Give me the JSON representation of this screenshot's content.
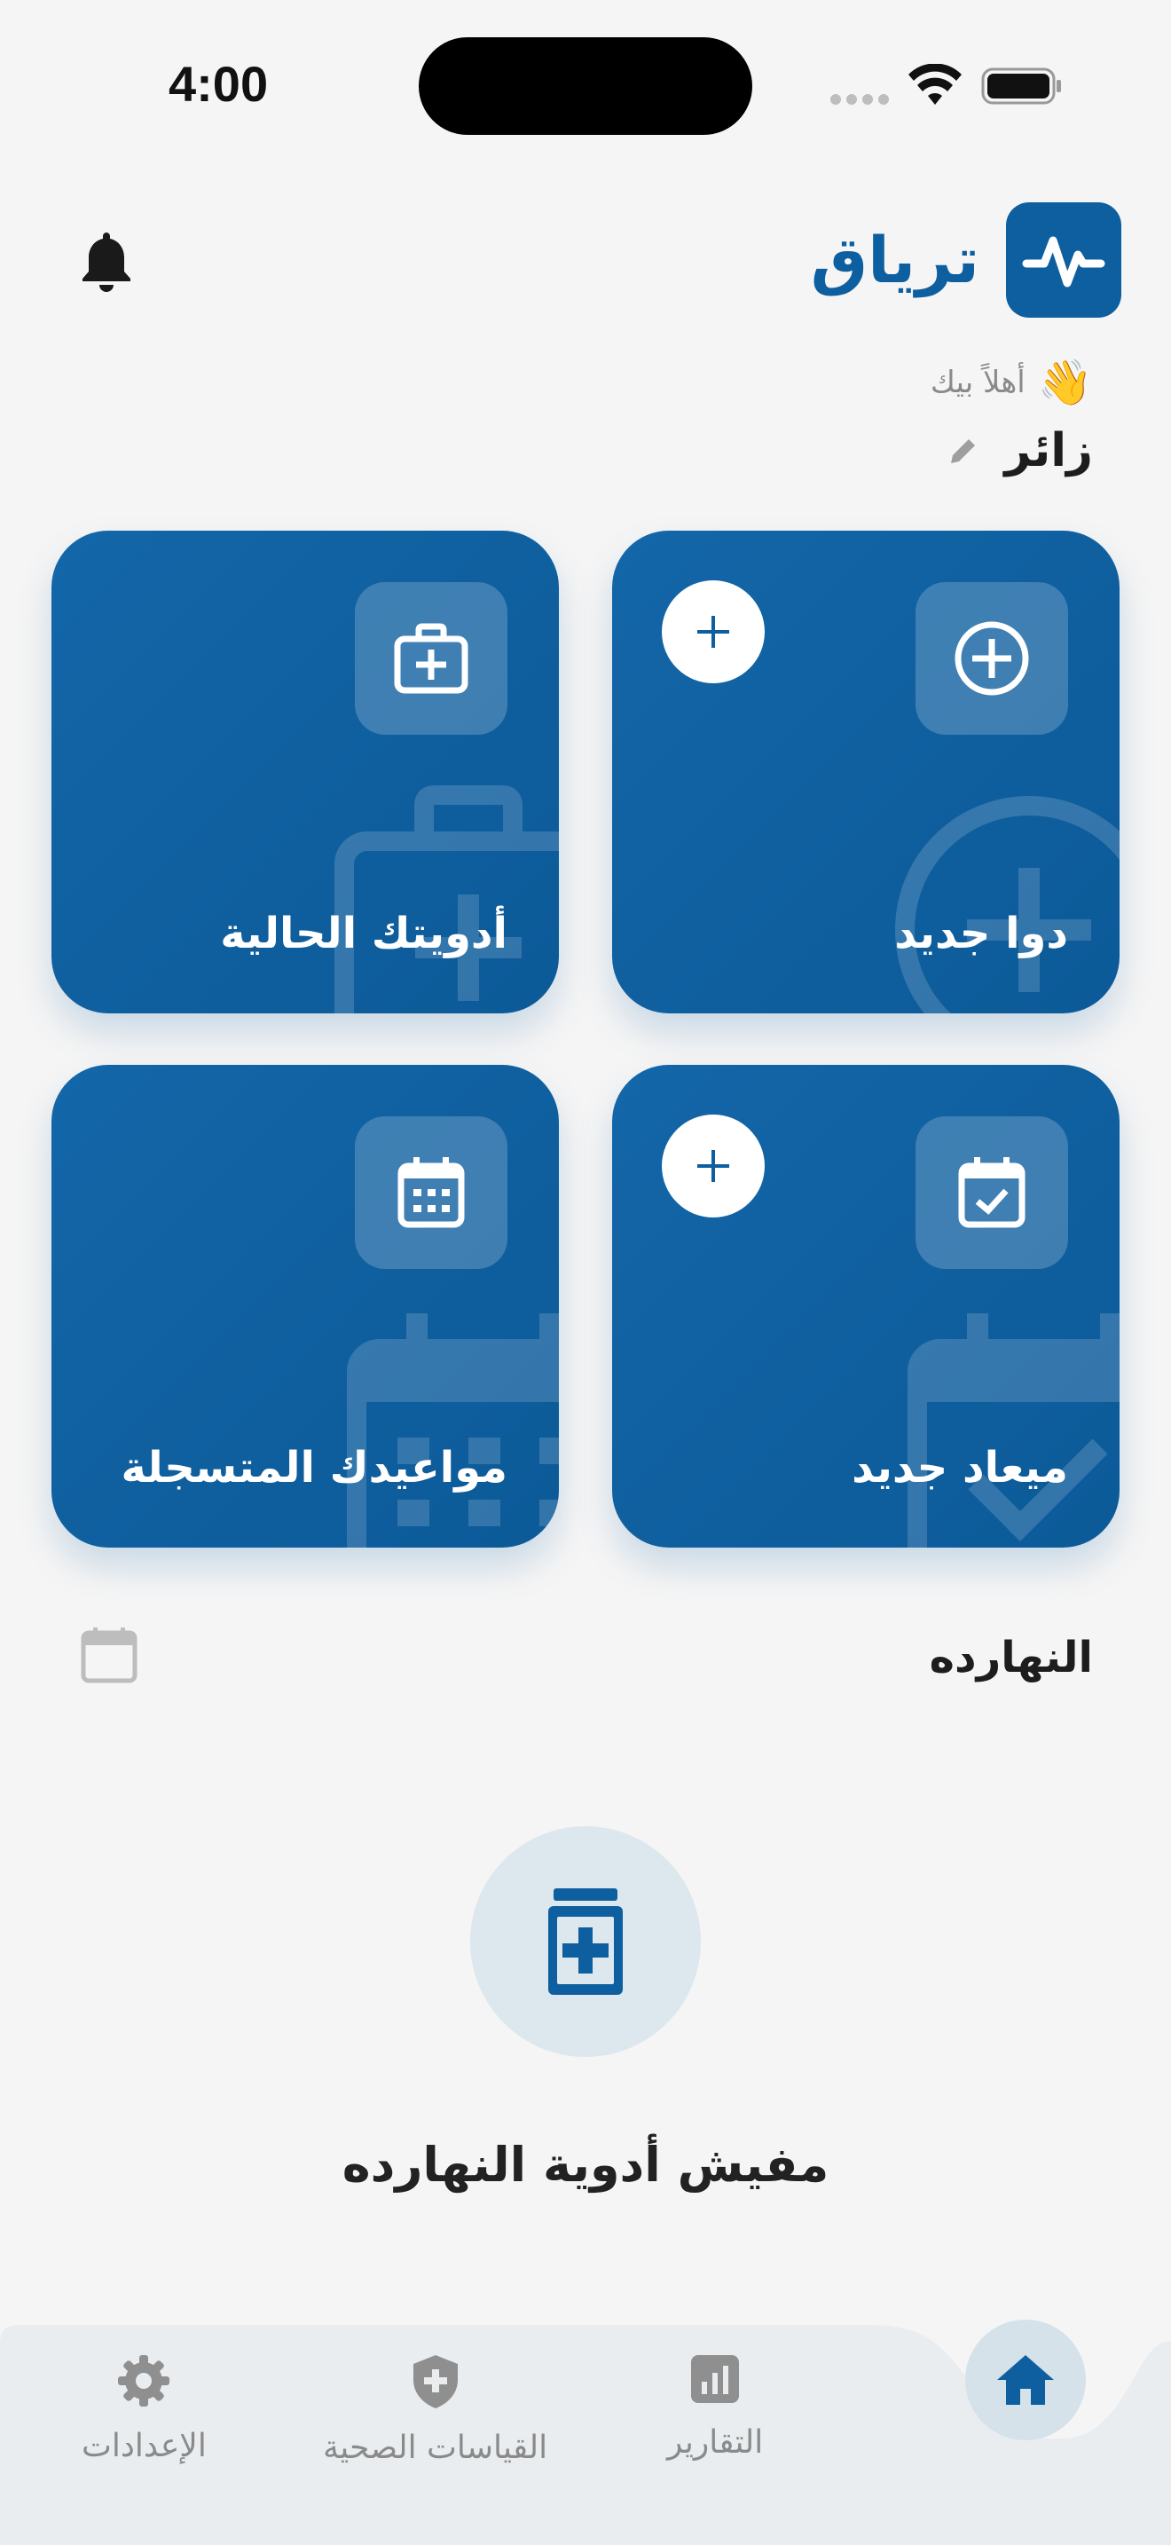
{
  "status_bar": {
    "time": "4:00"
  },
  "header": {
    "app_name": "ترياق",
    "greeting": "أهلاً بيك",
    "greeting_emoji": "👋",
    "user_name": "زائر",
    "icons": [
      "bell-icon",
      "pulse-logo-icon",
      "pencil-icon"
    ]
  },
  "cards": {
    "new_medicine": "دوا جديد",
    "current_medicines": "أدويتك الحالية",
    "new_appointment": "ميعاد جديد",
    "registered_appointments": "مواعيدك المتسجلة"
  },
  "today": {
    "title": "النهارده",
    "empty_message": "مفيش أدوية النهارده"
  },
  "bottom_nav": {
    "home": "home-icon",
    "reports": "التقارير",
    "health_measurements": "القياسات الصحية",
    "settings": "الإعدادات"
  },
  "colors": {
    "primary": "#0d5fa0",
    "background": "#f5f5f5",
    "nav_background": "#e9edf0",
    "muted_text": "#8a8a8a"
  }
}
